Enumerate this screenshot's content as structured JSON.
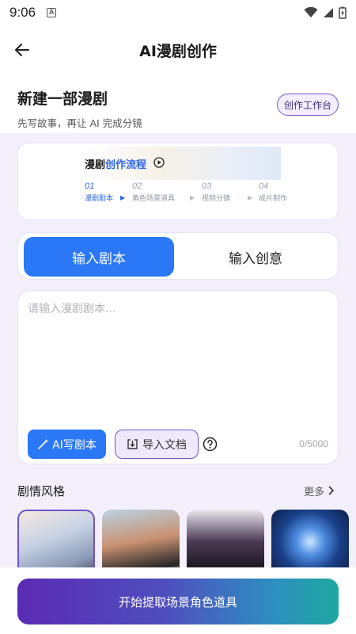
{
  "status_bar": {
    "time": "9:06",
    "a_badge": "A"
  },
  "header": {
    "title": "AI漫剧创作"
  },
  "intro": {
    "title": "新建一部漫剧",
    "subtitle": "先写故事，再让 AI 完成分镜",
    "workbench_label": "创作工作台"
  },
  "flow": {
    "title_part1": "漫剧",
    "title_part2": "创作流程",
    "steps": [
      {
        "num": "01",
        "label": "漫剧剧本"
      },
      {
        "num": "02",
        "label": "角色场景道具"
      },
      {
        "num": "03",
        "label": "视频分镜"
      },
      {
        "num": "04",
        "label": "成片制作"
      }
    ],
    "separator": "▶"
  },
  "tabs": {
    "script": "输入剧本",
    "idea": "输入创意"
  },
  "editor": {
    "placeholder": "请输入漫剧剧本...",
    "ai_write_label": "AI写剧本",
    "import_label": "导入文档",
    "char_count": "0/5000"
  },
  "style_section": {
    "title": "剧情风格",
    "more_label": "更多"
  },
  "styles": [
    {
      "name": "thumbnail-romance",
      "selected": true
    },
    {
      "name": "thumbnail-campus",
      "selected": false
    },
    {
      "name": "thumbnail-anime",
      "selected": false
    },
    {
      "name": "thumbnail-fantasy",
      "selected": false
    }
  ],
  "bottom": {
    "start_label": "开始提取场景角色道具"
  },
  "colors": {
    "accent_blue": "#2a78f6",
    "accent_purple": "#6d54c9",
    "button_gradient_start": "#5b2bb3",
    "button_gradient_end": "#1fa8a0",
    "content_bg": "#f3f0fb"
  }
}
